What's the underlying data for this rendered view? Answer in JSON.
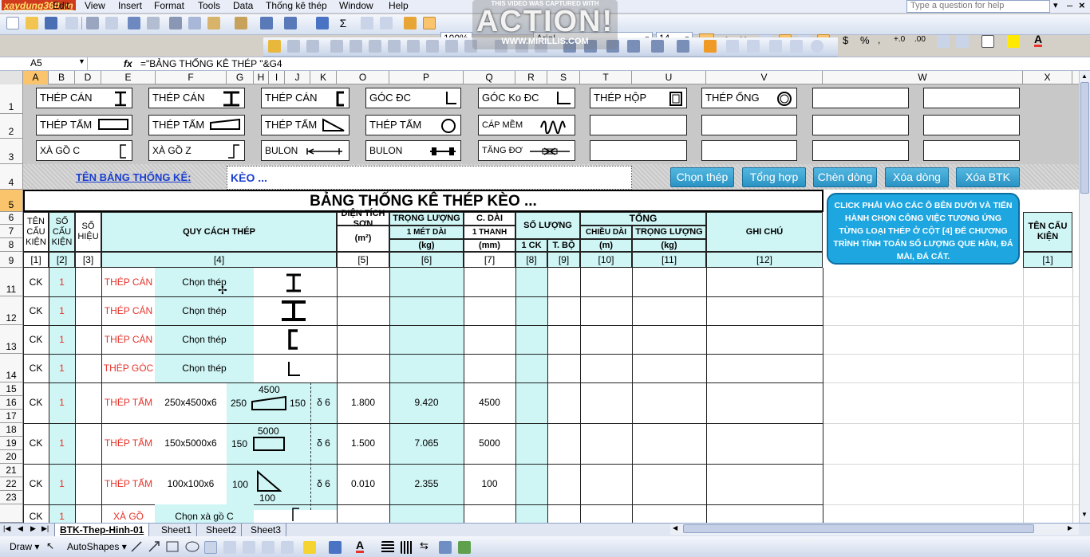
{
  "app": {
    "logo": "xaydung360.vn",
    "menu": [
      "File",
      "Edit",
      "View",
      "Insert",
      "Format",
      "Tools",
      "Data",
      "Thống kê thép",
      "Window",
      "Help"
    ],
    "help_placeholder": "Type a question for help",
    "zoom": "100%",
    "font_name": "Arial",
    "font_size": "14",
    "capture_overlay": {
      "caption": "THIS VIDEO WAS CAPTURED WITH",
      "brand": "ACTION!",
      "url": "WWW.MIRILLIS.COM"
    }
  },
  "formula_bar": {
    "cell_ref": "A5",
    "fx": "fx",
    "formula": "=\"BẢNG THỐNG KÊ THÉP \"&G4"
  },
  "columns": [
    "A",
    "B",
    "D",
    "E",
    "F",
    "G",
    "H",
    "I",
    "J",
    "K",
    "O",
    "P",
    "Q",
    "R",
    "S",
    "T",
    "U",
    "V",
    "W",
    "X"
  ],
  "rows": [
    "1",
    "2",
    "3",
    "4",
    "5",
    "6",
    "7",
    "8",
    "9",
    "11",
    "12",
    "13",
    "14",
    "15",
    "16",
    "17",
    "18",
    "19",
    "20",
    "21",
    "22",
    "23",
    ""
  ],
  "palette": {
    "r1": [
      "THÉP CÁN",
      "THÉP CÁN",
      "THÉP CÁN",
      "GÓC ĐC",
      "GÓC Ko ĐC",
      "THÉP HỘP",
      "THÉP ỐNG",
      "",
      ""
    ],
    "r2": [
      "THÉP TẤM",
      "THÉP TẤM",
      "THÉP TẤM",
      "THÉP TẤM",
      "CÁP MỀM",
      "",
      "",
      "",
      ""
    ],
    "r3": [
      "XÀ GỒ C",
      "XÀ GỒ Z",
      "BULON",
      "BULON",
      "TĂNG ĐƠ",
      "",
      "",
      "",
      ""
    ]
  },
  "table_name": {
    "label": "TÊN BẢNG THỐNG KÊ:",
    "value": "KÈO ..."
  },
  "buttons": [
    "Chọn thép",
    "Tổng hợp",
    "Chèn dòng",
    "Xóa dòng",
    "Xóa BTK"
  ],
  "title": "BẢNG THỐNG KÊ THÉP KÈO ...",
  "headers": {
    "ten_ck": "TÊN CẤU KIỆN",
    "so_ck": "SỐ CẤU KIỆN",
    "so_hieu": "SỐ HIỆU",
    "quy_cach": "QUY CÁCH THÉP",
    "dien_tich": "DIỆN TÍCH SƠN",
    "dien_tich_unit": "(m²)",
    "trong_luong": "TRỌNG LƯỢNG",
    "trong_luong_sub": "1 MÉT DÀI",
    "trong_luong_unit": "(kg)",
    "c_dai": "C. DÀI",
    "c_dai_sub": "1 THANH",
    "c_dai_unit": "(mm)",
    "so_luong": "SỐ LƯỢNG",
    "sl_1ck": "1 CK",
    "sl_tbo": "T. BỘ",
    "tong": "TỔNG",
    "chieu_dai": "CHIỀU DÀI",
    "chieu_dai_unit": "(m)",
    "tong_tl": "TRỌNG LƯỢNG",
    "tong_tl_unit": "(kg)",
    "ghi_chu": "GHI CHÚ",
    "ten_ck_right": "TÊN CẤU KIỆN"
  },
  "index_row": [
    "[1]",
    "[2]",
    "[3]",
    "[4]",
    "[5]",
    "[6]",
    "[7]",
    "[8]",
    "[9]",
    "[10]",
    "[11]",
    "[12]",
    "[1]"
  ],
  "note": "CLICK PHẢI VÀO CÁC Ô BÊN DƯỚI VÀ TIẾN HÀNH CHỌN CÔNG VIỆC TƯƠNG ỨNG TỪNG LOẠI THÉP Ở CỘT [4] ĐỂ CHƯƠNG TRÌNH TÍNH TOÁN SỐ LƯỢNG QUE HÀN, ĐÁ MÀI, ĐÁ CẮT.",
  "data_rows": [
    {
      "ck": "CK",
      "so": "1",
      "loai": "THÉP CÁN",
      "spec": "Chọn thép",
      "icon": "i-beam-icon"
    },
    {
      "ck": "CK",
      "so": "1",
      "loai": "THÉP CÁN",
      "spec": "Chọn thép",
      "icon": "h-beam-icon"
    },
    {
      "ck": "CK",
      "so": "1",
      "loai": "THÉP CÁN",
      "spec": "Chọn thép",
      "icon": "channel-icon"
    },
    {
      "ck": "CK",
      "so": "1",
      "loai": "THÉP GÓC",
      "spec": "Chọn thép",
      "icon": "angle-icon"
    },
    {
      "ck": "CK",
      "so": "1",
      "loai": "THÉP TẤM",
      "spec": "250x4500x6",
      "dim_left": "250",
      "dim_top": "4500",
      "dim_right": "150",
      "thick": "δ 6",
      "area": "1.800",
      "weight": "9.420",
      "length": "4500"
    },
    {
      "ck": "CK",
      "so": "1",
      "loai": "THÉP TẤM",
      "spec": "150x5000x6",
      "dim_left": "150",
      "dim_top": "5000",
      "thick": "δ 6",
      "area": "1.500",
      "weight": "7.065",
      "length": "5000"
    },
    {
      "ck": "CK",
      "so": "1",
      "loai": "THÉP TẤM",
      "spec": "100x100x6",
      "dim_left": "100",
      "dim_bottom": "100",
      "thick": "δ 6",
      "area": "0.010",
      "weight": "2.355",
      "length": "100"
    },
    {
      "ck": "CK",
      "so": "1",
      "loai": "XÀ GỒ",
      "spec": "Chọn xà gồ C"
    }
  ],
  "sheets": [
    "BTK-Thep-Hinh-01",
    "Sheet1",
    "Sheet2",
    "Sheet3"
  ],
  "drawbar": {
    "draw": "Draw ▾",
    "autoshapes": "AutoShapes ▾"
  }
}
